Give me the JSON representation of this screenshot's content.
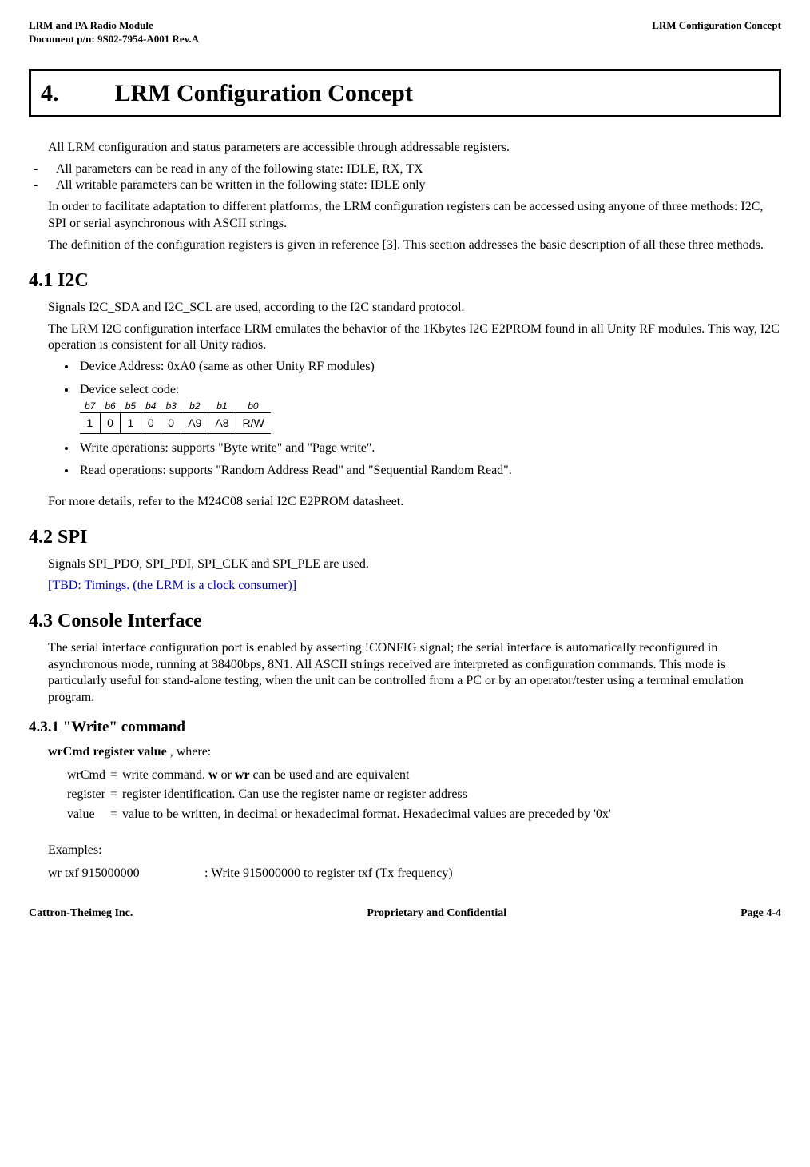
{
  "header": {
    "left1": "LRM and PA Radio Module",
    "left2": "Document p/n: 9S02-7954-A001 Rev.A",
    "right": "LRM Configuration Concept"
  },
  "title": {
    "num": "4.",
    "text": "LRM Configuration Concept"
  },
  "intro": {
    "p1": "All LRM configuration and status parameters are accessible through addressable registers.",
    "dash1": "All parameters can be read in any of the following state: IDLE, RX, TX",
    "dash2": "All writable parameters can be written in the following state: IDLE only",
    "p2": "In order to facilitate adaptation to different platforms, the LRM configuration registers can be accessed using anyone of three methods: I2C, SPI or serial asynchronous with ASCII strings.",
    "p3": "The definition of the configuration registers is given in reference [3].  This section addresses the basic description of all these three methods."
  },
  "s41": {
    "heading": "4.1    I2C",
    "p1": "Signals I2C_SDA and I2C_SCL are used, according to the I2C standard protocol.",
    "p2": "The LRM I2C configuration interface LRM emulates the behavior of the 1Kbytes I2C E2PROM found in all Unity RF modules.  This way, I2C operation is consistent for all Unity radios.",
    "b1": "Device Address: 0xA0 (same as other Unity RF modules)",
    "b2": "Device select code:",
    "bits": {
      "h": [
        "b7",
        "b6",
        "b5",
        "b4",
        "b3",
        "b2",
        "b1",
        "b0"
      ],
      "v": [
        "1",
        "0",
        "1",
        "0",
        "0",
        "A9",
        "A8"
      ]
    },
    "b3": "Write operations: supports \"Byte write\" and \"Page write\".",
    "b4": "Read operations: supports \"Random Address Read\" and \"Sequential Random Read\".",
    "p3": "For more details, refer to the M24C08 serial I2C E2PROM datasheet."
  },
  "s42": {
    "heading": "4.2    SPI",
    "p1": "Signals SPI_PDO, SPI_PDI, SPI_CLK and SPI_PLE are used.",
    "tbd": "[TBD: Timings. (the LRM is a clock consumer)]"
  },
  "s43": {
    "heading": "4.3    Console Interface",
    "p1": "The serial interface configuration port is enabled by asserting !CONFIG signal; the serial interface is automatically reconfigured in asynchronous mode, running at 38400bps, 8N1.  All ASCII strings received are interpreted as configuration commands.  This mode is particularly useful for stand-alone testing, when the unit can be controlled from a PC or by an operator/tester using a terminal emulation program."
  },
  "s431": {
    "heading": "4.3.1  \"Write\" command",
    "syntax_bold": "wrCmd register value",
    "syntax_tail": " ,  where:",
    "rows": [
      {
        "name": "wrCmd",
        "eq": "=",
        "desc_pre": "write command.  ",
        "desc_b": "w",
        "desc_mid": " or ",
        "desc_b2": "wr",
        "desc_post": " can be used and are equivalent"
      },
      {
        "name": "register",
        "eq": "=",
        "desc": "register identification. Can use the register name or register address"
      },
      {
        "name": "value",
        "eq": "=",
        "desc": "value to be written, in decimal or hexadecimal format.  Hexadecimal values are preceded by '0x'"
      }
    ],
    "ex_label": "Examples:",
    "ex1_cmd": "wr txf 915000000",
    "ex1_desc": ": Write 915000000 to register txf (Tx frequency)"
  },
  "footer": {
    "left": "Cattron-Theimeg Inc.",
    "center": "Proprietary and Confidential",
    "right": "Page  4-4"
  }
}
